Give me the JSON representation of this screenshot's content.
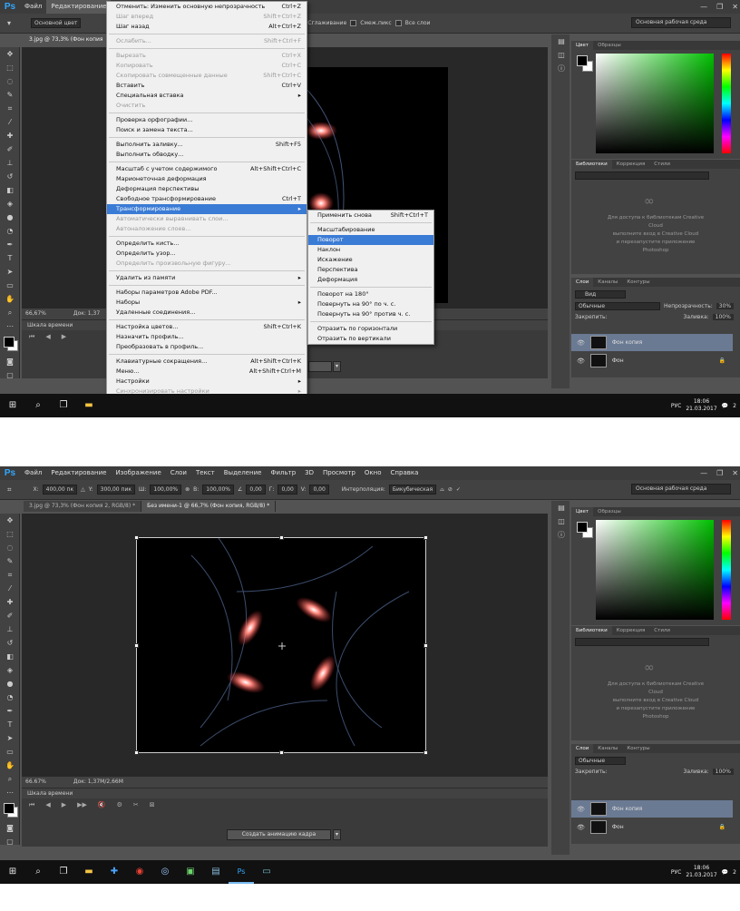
{
  "shot1": {
    "menubar": [
      "Файл",
      "Редактирование",
      "Изображение",
      "Слои",
      "Текст",
      "Выделение",
      "Фильтр",
      "3D",
      "Просмотр",
      "Окно",
      "Справка"
    ],
    "active_menu": "Редактирование",
    "options": {
      "mode": "Основной цвет",
      "smoothing": "Сглаживание",
      "contiguous": "Смеж.пикс",
      "all_layers": "Все слои"
    },
    "workspace": "Основная рабочая среда",
    "doc_tab": "3.jpg @ 73,3% (Фон копия",
    "zoom": "66,67%",
    "doc_size": "Док: 1,37",
    "timeline_title": "Шкала времени",
    "edit_menu": [
      {
        "label": "Отменить: Изменить основную непрозрачность",
        "sc": "Ctrl+Z",
        "dis": false
      },
      {
        "label": "Шаг вперед",
        "sc": "Shift+Ctrl+Z",
        "dis": true
      },
      {
        "label": "Шаг назад",
        "sc": "Alt+Ctrl+Z",
        "dis": false
      },
      {
        "sep": true
      },
      {
        "label": "Ослабить...",
        "sc": "Shift+Ctrl+F",
        "dis": true
      },
      {
        "sep": true
      },
      {
        "label": "Вырезать",
        "sc": "Ctrl+X",
        "dis": true
      },
      {
        "label": "Копировать",
        "sc": "Ctrl+C",
        "dis": true
      },
      {
        "label": "Скопировать совмещенные данные",
        "sc": "Shift+Ctrl+C",
        "dis": true
      },
      {
        "label": "Вставить",
        "sc": "Ctrl+V",
        "dis": false
      },
      {
        "label": "Специальная вставка",
        "sc": "",
        "dis": false,
        "arrow": true
      },
      {
        "label": "Очистить",
        "sc": "",
        "dis": true
      },
      {
        "sep": true
      },
      {
        "label": "Проверка орфографии...",
        "sc": "",
        "dis": false
      },
      {
        "label": "Поиск и замена текста...",
        "sc": "",
        "dis": false
      },
      {
        "sep": true
      },
      {
        "label": "Выполнить заливку...",
        "sc": "Shift+F5",
        "dis": false
      },
      {
        "label": "Выполнить обводку...",
        "sc": "",
        "dis": false
      },
      {
        "sep": true
      },
      {
        "label": "Масштаб с учетом содержимого",
        "sc": "Alt+Shift+Ctrl+C",
        "dis": false
      },
      {
        "label": "Марионеточная деформация",
        "sc": "",
        "dis": false
      },
      {
        "label": "Деформация перспективы",
        "sc": "",
        "dis": false
      },
      {
        "label": "Свободное трансформирование",
        "sc": "Ctrl+T",
        "dis": false
      },
      {
        "label": "Трансформирование",
        "sc": "",
        "dis": false,
        "hl": true,
        "arrow": true
      },
      {
        "label": "Автоматически выравнивать слои...",
        "sc": "",
        "dis": true
      },
      {
        "label": "Автоналожение слоев...",
        "sc": "",
        "dis": true
      },
      {
        "sep": true
      },
      {
        "label": "Определить кисть...",
        "sc": "",
        "dis": false
      },
      {
        "label": "Определить узор...",
        "sc": "",
        "dis": false
      },
      {
        "label": "Определить произвольную фигуру...",
        "sc": "",
        "dis": true
      },
      {
        "sep": true
      },
      {
        "label": "Удалить из памяти",
        "sc": "",
        "dis": false,
        "arrow": true
      },
      {
        "sep": true
      },
      {
        "label": "Наборы параметров Adobe PDF...",
        "sc": "",
        "dis": false
      },
      {
        "label": "Наборы",
        "sc": "",
        "dis": false,
        "arrow": true
      },
      {
        "label": "Удаленные соединения...",
        "sc": "",
        "dis": false
      },
      {
        "sep": true
      },
      {
        "label": "Настройка цветов...",
        "sc": "Shift+Ctrl+K",
        "dis": false
      },
      {
        "label": "Назначить профиль...",
        "sc": "",
        "dis": false
      },
      {
        "label": "Преобразовать в профиль...",
        "sc": "",
        "dis": false
      },
      {
        "sep": true
      },
      {
        "label": "Клавиатурные сокращения...",
        "sc": "Alt+Shift+Ctrl+K",
        "dis": false
      },
      {
        "label": "Меню...",
        "sc": "Alt+Shift+Ctrl+M",
        "dis": false
      },
      {
        "label": "Настройки",
        "sc": "",
        "dis": false,
        "arrow": true
      },
      {
        "label": "Синхронизировать настройки",
        "sc": "",
        "dis": true,
        "arrow": true
      }
    ],
    "transform_menu": [
      {
        "label": "Применить снова",
        "sc": "Shift+Ctrl+T"
      },
      {
        "sep": true
      },
      {
        "label": "Масштабирование",
        "sc": ""
      },
      {
        "label": "Поворот",
        "sc": "",
        "hl": true
      },
      {
        "label": "Наклон",
        "sc": ""
      },
      {
        "label": "Искажение",
        "sc": ""
      },
      {
        "label": "Перспектива",
        "sc": ""
      },
      {
        "label": "Деформация",
        "sc": ""
      },
      {
        "sep": true
      },
      {
        "label": "Поворот на 180°",
        "sc": ""
      },
      {
        "label": "Повернуть на 90° по ч. с.",
        "sc": ""
      },
      {
        "label": "Повернуть на 90° против ч. с.",
        "sc": ""
      },
      {
        "sep": true
      },
      {
        "label": "Отразить по горизонтали",
        "sc": ""
      },
      {
        "label": "Отразить по вертикали",
        "sc": ""
      }
    ]
  },
  "shot2": {
    "menubar": [
      "Файл",
      "Редактирование",
      "Изображение",
      "Слои",
      "Текст",
      "Выделение",
      "Фильтр",
      "3D",
      "Просмотр",
      "Окно",
      "Справка"
    ],
    "options": {
      "x_label": "X:",
      "x": "400,00 пк",
      "y_label": "Y:",
      "y": "300,00 пик",
      "w_label": "Ш:",
      "w": "100,00%",
      "h_label": "В:",
      "h": "100,00%",
      "angle": "0,00",
      "h_skew_label": "Г:",
      "h_skew": "0,00",
      "v_skew_label": "V:",
      "v_skew": "0,00",
      "interp_label": "Интерполяция:",
      "interp": "Бикубическая"
    },
    "workspace": "Основная рабочая среда",
    "doc_tabs": [
      "3.jpg @ 73,3% (Фон копия 2, RGB/8) *",
      "Без имени-1 @ 66,7% (Фон копия, RGB/8) *"
    ],
    "zoom": "66.67%",
    "doc_size": "Док: 1,37М/2,66М",
    "timeline_title": "Шкала времени",
    "make_video": "Создать анимацию кадра"
  },
  "panels": {
    "color_tabs": [
      "Цвет",
      "Образцы"
    ],
    "lib_tabs": [
      "Библиотеки",
      "Коррекция",
      "Стили"
    ],
    "lib_message": [
      "Для доступа к библиотекам Creative",
      "Cloud",
      "выполните вход в Creative Cloud",
      "и перезапустите приложение",
      "Photoshop"
    ],
    "layers_tabs": [
      "Слои",
      "Каналы",
      "Контуры"
    ],
    "kind": "Вид",
    "blend": "Обычные",
    "opacity_label": "Непрозрачность:",
    "opacity": "30%",
    "lock_label": "Закрепить:",
    "fill_label": "Заливка:",
    "fill": "100%",
    "layers": [
      {
        "name": "Фон копия",
        "selected": true
      },
      {
        "name": "Фон",
        "selected": false
      }
    ]
  },
  "taskbar": {
    "lang": "РУС",
    "time": "18:06",
    "date": "21.03.2017",
    "notif": "2"
  }
}
